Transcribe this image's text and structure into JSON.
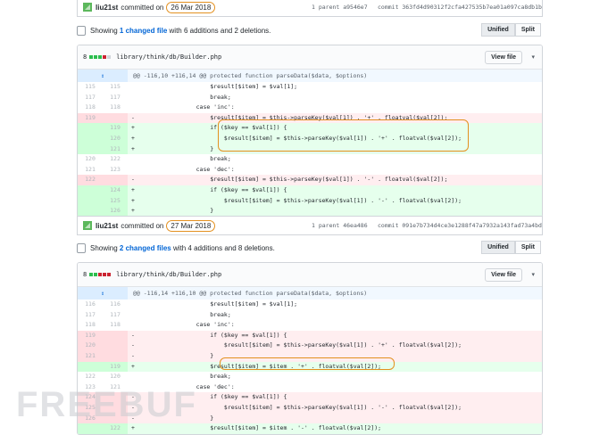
{
  "commit1": {
    "user": "liu21st",
    "verb": "committed on",
    "date": "26 Mar 2018",
    "parent": "1 parent a9546e7",
    "sha": "commit 363fd4d90312f2cfa427535b7ea01a097ca8db1b"
  },
  "toc1": {
    "showing": "Showing",
    "changed": "1 changed file",
    "rest": "with 6 additions and 2 deletions.",
    "unified": "Unified",
    "split": "Split"
  },
  "file1": {
    "count": "8",
    "path": "library/think/db/Builder.php",
    "view": "View file",
    "hunk": "@@ -116,10 +116,14 @@ protected function parseData($data, $options)",
    "rows": [
      {
        "t": "ctx",
        "o": "115",
        "n": "115",
        "s": "",
        "c": "                    $result[$item] = $val[1];"
      },
      {
        "t": "ctx",
        "o": "117",
        "n": "117",
        "s": "",
        "c": "                    break;"
      },
      {
        "t": "ctx",
        "o": "118",
        "n": "118",
        "s": "",
        "c": "                case 'inc':"
      },
      {
        "t": "del",
        "o": "119",
        "n": "",
        "s": "-",
        "c": "                    $result[$item] = $this->parseKey($val[1]) . '+' . floatval($val[2]);"
      },
      {
        "t": "add",
        "o": "",
        "n": "119",
        "s": "+",
        "c": "                    if ($key == $val[1]) {"
      },
      {
        "t": "add",
        "o": "",
        "n": "120",
        "s": "+",
        "c": "                        $result[$item] = $this->parseKey($val[1]) . '+' . floatval($val[2]);"
      },
      {
        "t": "add",
        "o": "",
        "n": "121",
        "s": "+",
        "c": "                    }"
      },
      {
        "t": "ctx",
        "o": "120",
        "n": "122",
        "s": "",
        "c": "                    break;"
      },
      {
        "t": "ctx",
        "o": "121",
        "n": "123",
        "s": "",
        "c": "                case 'dec':"
      },
      {
        "t": "del",
        "o": "122",
        "n": "",
        "s": "-",
        "c": "                    $result[$item] = $this->parseKey($val[1]) . '-' . floatval($val[2]);"
      },
      {
        "t": "add",
        "o": "",
        "n": "124",
        "s": "+",
        "c": "                    if ($key == $val[1]) {"
      },
      {
        "t": "add",
        "o": "",
        "n": "125",
        "s": "+",
        "c": "                        $result[$item] = $this->parseKey($val[1]) . '-' . floatval($val[2]);"
      },
      {
        "t": "add",
        "o": "",
        "n": "126",
        "s": "+",
        "c": "                    }"
      }
    ]
  },
  "commit2": {
    "user": "liu21st",
    "verb": "committed on",
    "date": "27 Mar 2018",
    "parent": "1 parent 46ea486",
    "sha": "commit 091e7b734d4ce3e1288f47a7932a143fad73a4bd"
  },
  "toc2": {
    "showing": "Showing",
    "changed": "2 changed files",
    "rest": "with 4 additions and 8 deletions.",
    "unified": "Unified",
    "split": "Split"
  },
  "file2": {
    "count": "8",
    "path": "library/think/db/Builder.php",
    "view": "View file",
    "hunk": "@@ -116,14 +116,10 @@ protected function parseData($data, $options)",
    "rows": [
      {
        "t": "ctx",
        "o": "116",
        "n": "116",
        "s": "",
        "c": "                    $result[$item] = $val[1];"
      },
      {
        "t": "ctx",
        "o": "117",
        "n": "117",
        "s": "",
        "c": "                    break;"
      },
      {
        "t": "ctx",
        "o": "118",
        "n": "118",
        "s": "",
        "c": "                case 'inc':"
      },
      {
        "t": "del",
        "o": "119",
        "n": "",
        "s": "-",
        "c": "                    if ($key == $val[1]) {"
      },
      {
        "t": "del",
        "o": "120",
        "n": "",
        "s": "-",
        "c": "                        $result[$item] = $this->parseKey($val[1]) . '+' . floatval($val[2]);"
      },
      {
        "t": "del",
        "o": "121",
        "n": "",
        "s": "-",
        "c": "                    }"
      },
      {
        "t": "add",
        "o": "",
        "n": "119",
        "s": "+",
        "c": "                    $result[$item] = $item . '+' . floatval($val[2]);"
      },
      {
        "t": "ctx",
        "o": "122",
        "n": "120",
        "s": "",
        "c": "                    break;"
      },
      {
        "t": "ctx",
        "o": "123",
        "n": "121",
        "s": "",
        "c": "                case 'dec':"
      },
      {
        "t": "del",
        "o": "124",
        "n": "",
        "s": "-",
        "c": "                    if ($key == $val[1]) {"
      },
      {
        "t": "del",
        "o": "125",
        "n": "",
        "s": "-",
        "c": "                        $result[$item] = $this->parseKey($val[1]) . '-' . floatval($val[2]);"
      },
      {
        "t": "del",
        "o": "126",
        "n": "",
        "s": "-",
        "c": "                    }"
      },
      {
        "t": "add",
        "o": "",
        "n": "122",
        "s": "+",
        "c": "                    $result[$item] = $item . '-' . floatval($val[2]);"
      }
    ]
  },
  "watermark": "FREEBUF",
  "colors": {
    "accent": "#e3901f",
    "link": "#0366d6",
    "add": "#e6ffed",
    "del": "#ffeef0"
  },
  "icons": [
    "avatar-icon",
    "clipboard-icon",
    "chevron-down-icon"
  ]
}
